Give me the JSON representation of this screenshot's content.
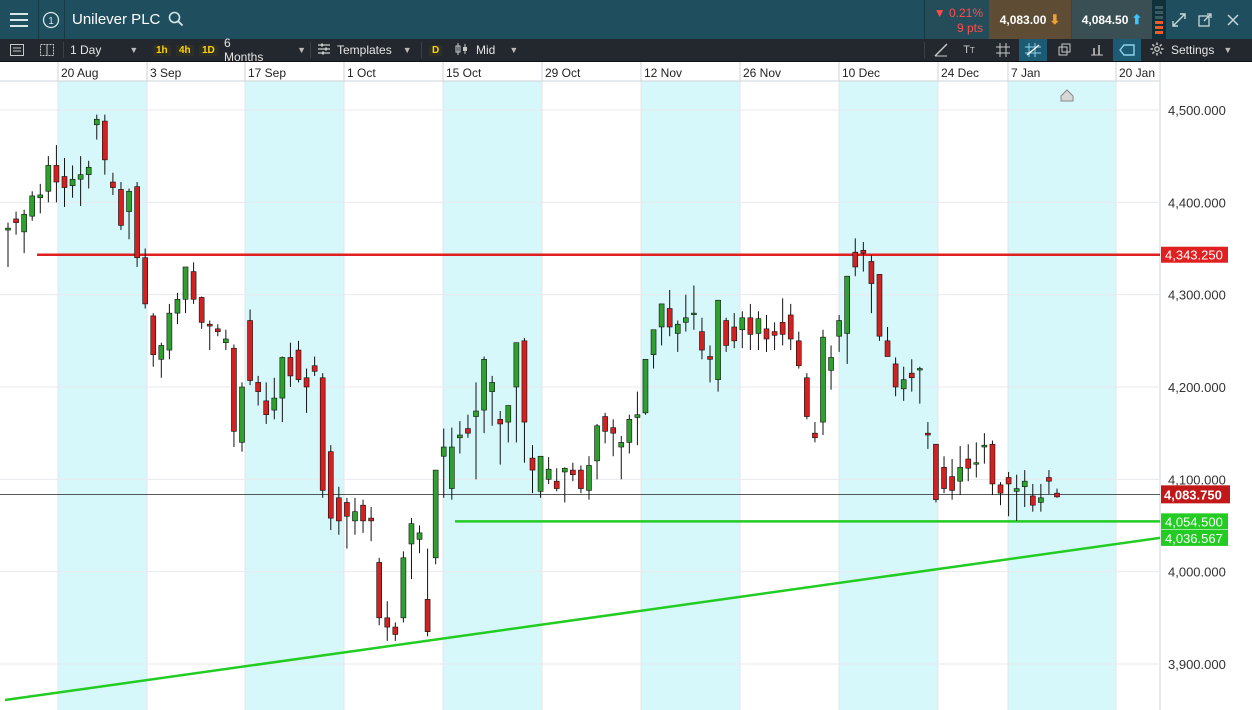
{
  "header": {
    "title": "Unilever PLC",
    "change_pct": "▼ 0.21%",
    "change_pts": "9 pts",
    "sell_price": "4,083.00",
    "buy_price": "4,084.50",
    "colors": {
      "down": "#ff4d4d",
      "sell_bg": "#5e4d34",
      "buy_bg": "#3a4f54"
    }
  },
  "toolbar": {
    "interval": "1 Day",
    "quick_intervals": [
      "1h",
      "4h",
      "1D"
    ],
    "range": "6 Months",
    "templates_label": "Templates",
    "type_badge": "D",
    "price_mode": "Mid",
    "settings_label": "Settings"
  },
  "chart_data": {
    "type": "candlestick",
    "x_ticks": [
      "20 Aug",
      "3 Sep",
      "17 Sep",
      "1 Oct",
      "15 Oct",
      "29 Oct",
      "12 Nov",
      "26 Nov",
      "10 Dec",
      "24 Dec",
      "7 Jan",
      "20 Jan"
    ],
    "y_ticks": [
      "4,500.000",
      "4,400.000",
      "4,300.000",
      "4,200.000",
      "4,100.000",
      "4,000.000",
      "3,900.000"
    ],
    "y_tick_values": [
      4500,
      4400,
      4300,
      4200,
      4100,
      4000,
      3900
    ],
    "current_price": "4,083.750",
    "horizontal_lines": [
      {
        "label": "4,343.250",
        "value": 4343.25,
        "color": "#e02020"
      },
      {
        "label": "4,054.500",
        "value": 4054.5,
        "color": "#22cc22"
      }
    ],
    "trend_line_label": "4,036.567",
    "trend_line": {
      "color": "#22cc22",
      "start_value": 3861,
      "end_value": 4036.567
    },
    "candles": [
      [
        4370,
        4378,
        4330,
        4372
      ],
      [
        4382,
        4390,
        4365,
        4378
      ],
      [
        4368,
        4392,
        4345,
        4387
      ],
      [
        4385,
        4412,
        4380,
        4407
      ],
      [
        4405,
        4420,
        4388,
        4408
      ],
      [
        4412,
        4450,
        4400,
        4440
      ],
      [
        4440,
        4462,
        4400,
        4422
      ],
      [
        4428,
        4448,
        4395,
        4416
      ],
      [
        4418,
        4440,
        4405,
        4425
      ],
      [
        4425,
        4450,
        4396,
        4430
      ],
      [
        4430,
        4445,
        4415,
        4438
      ],
      [
        4484,
        4495,
        4468,
        4490
      ],
      [
        4488,
        4495,
        4430,
        4446
      ],
      [
        4422,
        4432,
        4408,
        4416
      ],
      [
        4414,
        4422,
        4370,
        4375
      ],
      [
        4390,
        4415,
        4360,
        4412
      ],
      [
        4417,
        4422,
        4330,
        4340
      ],
      [
        4340,
        4350,
        4285,
        4290
      ],
      [
        4277,
        4280,
        4222,
        4235
      ],
      [
        4230,
        4248,
        4210,
        4245
      ],
      [
        4240,
        4290,
        4230,
        4280
      ],
      [
        4280,
        4302,
        4268,
        4295
      ],
      [
        4295,
        4330,
        4280,
        4330
      ],
      [
        4325,
        4335,
        4290,
        4295
      ],
      [
        4297,
        4298,
        4263,
        4270
      ],
      [
        4268,
        4272,
        4240,
        4266
      ],
      [
        4263,
        4268,
        4255,
        4260
      ],
      [
        4248,
        4262,
        4240,
        4252
      ],
      [
        4242,
        4246,
        4135,
        4152
      ],
      [
        4140,
        4205,
        4130,
        4200
      ],
      [
        4272,
        4284,
        4202,
        4207
      ],
      [
        4205,
        4212,
        4180,
        4195
      ],
      [
        4185,
        4205,
        4160,
        4170
      ],
      [
        4175,
        4210,
        4165,
        4188
      ],
      [
        4188,
        4233,
        4162,
        4232
      ],
      [
        4232,
        4248,
        4200,
        4212
      ],
      [
        4240,
        4250,
        4205,
        4208
      ],
      [
        4210,
        4220,
        4172,
        4200
      ],
      [
        4223,
        4233,
        4212,
        4217
      ],
      [
        4210,
        4215,
        4080,
        4088
      ],
      [
        4130,
        4137,
        4045,
        4058
      ],
      [
        4080,
        4092,
        4040,
        4055
      ],
      [
        4075,
        4080,
        4025,
        4060
      ],
      [
        4055,
        4080,
        4040,
        4065
      ],
      [
        4072,
        4078,
        4042,
        4055
      ],
      [
        4058,
        4070,
        4033,
        4055
      ],
      [
        4010,
        4015,
        3942,
        3950
      ],
      [
        3950,
        3968,
        3925,
        3940
      ],
      [
        3940,
        3945,
        3925,
        3932
      ],
      [
        3950,
        4022,
        3945,
        4015
      ],
      [
        4030,
        4058,
        3992,
        4052
      ],
      [
        4035,
        4050,
        4020,
        4042
      ],
      [
        3970,
        4025,
        3930,
        3935
      ],
      [
        4015,
        4110,
        4008,
        4110
      ],
      [
        4125,
        4155,
        4080,
        4135
      ],
      [
        4090,
        4156,
        4078,
        4135
      ],
      [
        4145,
        4163,
        4128,
        4148
      ],
      [
        4155,
        4170,
        4145,
        4150
      ],
      [
        4168,
        4205,
        4100,
        4174
      ],
      [
        4175,
        4233,
        4150,
        4230
      ],
      [
        4195,
        4212,
        4158,
        4205
      ],
      [
        4165,
        4174,
        4116,
        4160
      ],
      [
        4162,
        4180,
        4140,
        4180
      ],
      [
        4200,
        4248,
        4140,
        4248
      ],
      [
        4250,
        4253,
        4118,
        4162
      ],
      [
        4123,
        4137,
        4085,
        4110
      ],
      [
        4087,
        4123,
        4080,
        4125
      ],
      [
        4100,
        4124,
        4095,
        4111
      ],
      [
        4098,
        4112,
        4087,
        4090
      ],
      [
        4108,
        4113,
        4075,
        4112
      ],
      [
        4110,
        4118,
        4098,
        4105
      ],
      [
        4110,
        4115,
        4085,
        4090
      ],
      [
        4088,
        4125,
        4078,
        4115
      ],
      [
        4120,
        4160,
        4100,
        4158
      ],
      [
        4168,
        4172,
        4139,
        4152
      ],
      [
        4156,
        4165,
        4125,
        4150
      ],
      [
        4135,
        4147,
        4100,
        4140
      ],
      [
        4140,
        4170,
        4128,
        4165
      ],
      [
        4167,
        4195,
        4137,
        4170
      ],
      [
        4172,
        4230,
        4170,
        4230
      ],
      [
        4235,
        4262,
        4220,
        4262
      ],
      [
        4265,
        4290,
        4245,
        4290
      ],
      [
        4285,
        4305,
        4255,
        4265
      ],
      [
        4258,
        4272,
        4238,
        4268
      ],
      [
        4270,
        4300,
        4260,
        4275
      ],
      [
        4280,
        4310,
        4262,
        4280
      ],
      [
        4260,
        4275,
        4230,
        4240
      ],
      [
        4233,
        4245,
        4205,
        4230
      ],
      [
        4208,
        4278,
        4195,
        4294
      ],
      [
        4272,
        4275,
        4238,
        4245
      ],
      [
        4265,
        4280,
        4242,
        4250
      ],
      [
        4262,
        4282,
        4242,
        4275
      ],
      [
        4275,
        4290,
        4240,
        4257
      ],
      [
        4258,
        4282,
        4240,
        4274
      ],
      [
        4263,
        4278,
        4238,
        4252
      ],
      [
        4260,
        4270,
        4240,
        4256
      ],
      [
        4270,
        4296,
        4245,
        4257
      ],
      [
        4278,
        4290,
        4240,
        4252
      ],
      [
        4250,
        4260,
        4220,
        4223
      ],
      [
        4210,
        4215,
        4165,
        4168
      ],
      [
        4150,
        4162,
        4140,
        4145
      ],
      [
        4162,
        4262,
        4148,
        4254
      ],
      [
        4218,
        4245,
        4197,
        4232
      ],
      [
        4255,
        4278,
        4238,
        4272
      ],
      [
        4258,
        4320,
        4225,
        4320
      ],
      [
        4346,
        4361,
        4320,
        4330
      ],
      [
        4348,
        4357,
        4325,
        4345
      ],
      [
        4336,
        4343,
        4280,
        4312
      ],
      [
        4322,
        4310,
        4250,
        4255
      ],
      [
        4250,
        4265,
        4233,
        4233
      ],
      [
        4225,
        4232,
        4190,
        4200
      ],
      [
        4198,
        4222,
        4185,
        4208
      ],
      [
        4215,
        4230,
        4195,
        4210
      ],
      [
        4220,
        4222,
        4182,
        4220
      ],
      [
        4150,
        4162,
        4133,
        4148
      ],
      [
        4138,
        4138,
        4075,
        4078
      ],
      [
        4113,
        4125,
        4085,
        4090
      ],
      [
        4103,
        4122,
        4078,
        4088
      ],
      [
        4098,
        4136,
        4083,
        4113
      ],
      [
        4122,
        4138,
        4098,
        4112
      ],
      [
        4118,
        4140,
        4102,
        4118
      ],
      [
        4135,
        4150,
        4117,
        4137
      ],
      [
        4138,
        4142,
        4083,
        4095
      ],
      [
        4094,
        4097,
        4072,
        4085
      ],
      [
        4102,
        4108,
        4060,
        4095
      ],
      [
        4087,
        4105,
        4055,
        4090
      ],
      [
        4092,
        4110,
        4070,
        4098
      ],
      [
        4082,
        4095,
        4065,
        4072
      ],
      [
        4075,
        4095,
        4065,
        4080
      ],
      [
        4102,
        4110,
        4084,
        4098
      ],
      [
        4085,
        4090,
        4080,
        4081
      ]
    ]
  }
}
